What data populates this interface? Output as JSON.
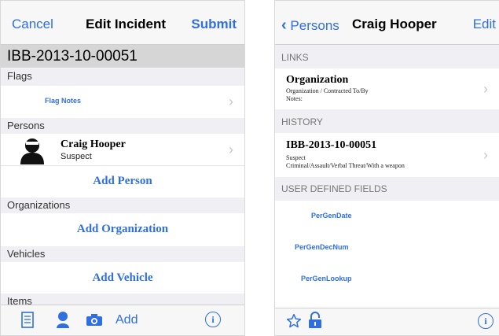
{
  "left": {
    "nav": {
      "cancel": "Cancel",
      "title": "Edit Incident",
      "submit": "Submit"
    },
    "incident_number": "IBB-2013-10-00051",
    "sections": {
      "flags": "Flags",
      "persons": "Persons",
      "organizations": "Organizations",
      "vehicles": "Vehicles",
      "items": "Items"
    },
    "flag_notes": "Flag Notes",
    "person": {
      "name": "Craig Hooper",
      "role": "Suspect"
    },
    "add_person": "Add Person",
    "add_organization": "Add Organization",
    "add_vehicle": "Add Vehicle",
    "toolbar": {
      "add_label": "Add",
      "icons": [
        "document-icon",
        "person-icon",
        "camera-icon",
        "info-icon"
      ]
    }
  },
  "right": {
    "nav": {
      "back": "Persons",
      "title": "Craig Hooper",
      "edit": "Edit"
    },
    "sections": {
      "links": "LINKS",
      "history": "HISTORY",
      "udf": "USER DEFINED FIELDS"
    },
    "organization": {
      "title": "Organization",
      "line1": "Organization / Contracted To/By",
      "line2": "Notes:"
    },
    "history_item": {
      "title": "IBB-2013-10-00051",
      "line1": "Suspect",
      "line2": "Criminal/Assault/Verbal Threat/With a weapon"
    },
    "udf_fields": [
      "PerGenDate",
      "PerGenDecNum",
      "PerGenLookup"
    ],
    "toolbar": {
      "icons": [
        "star-icon",
        "lock-icon",
        "info-icon"
      ]
    }
  },
  "colors": {
    "accent": "#2f6fe0",
    "section_bg": "#efeff4",
    "incident_bar": "#d6d6d6"
  }
}
